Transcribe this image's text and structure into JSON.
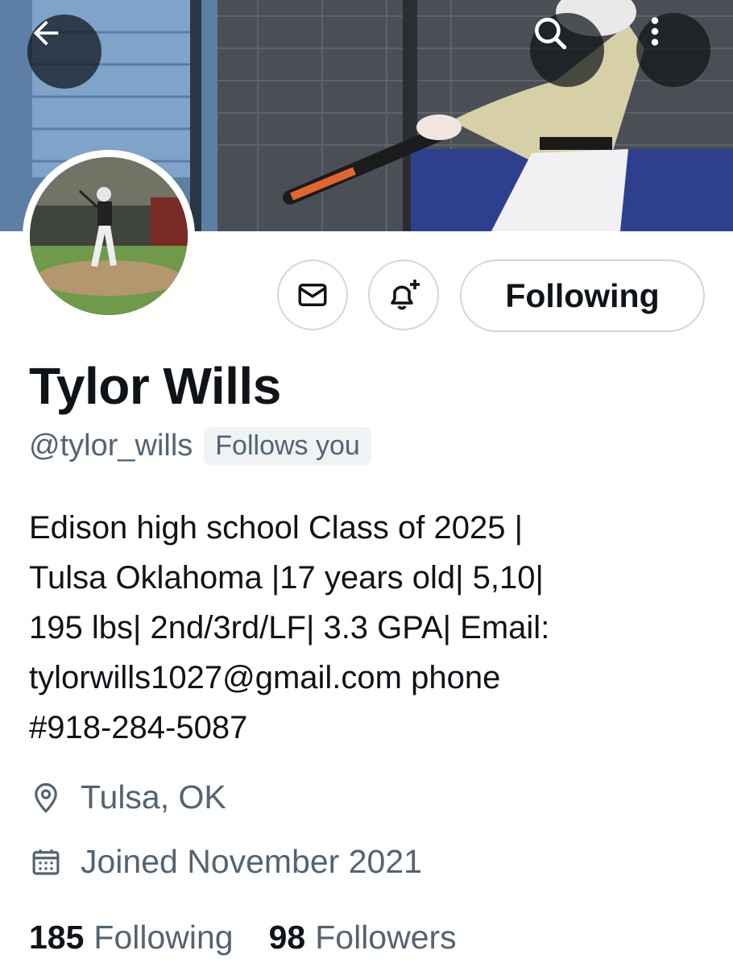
{
  "profile": {
    "name": "Tylor Wills",
    "handle": "@tylor_wills",
    "follows_you": "Follows you",
    "bio": "Edison high school Class of 2025 |\nTulsa Oklahoma |17 years old| 5,10|\n195 lbs| 2nd/3rd/LF| 3.3 GPA| Email:\ntylorwills1027@gmail.com phone\n#918-284-5087",
    "location": "Tulsa, OK",
    "joined": "Joined November 2021",
    "following_count": "185",
    "following_label": "Following",
    "followers_count": "98",
    "followers_label": "Followers"
  },
  "actions": {
    "following_button": "Following"
  },
  "icons": {
    "back": "arrow-left-icon",
    "search": "search-icon",
    "more": "more-vertical-icon",
    "message": "envelope-icon",
    "notify": "bell-plus-icon",
    "location": "location-pin-icon",
    "calendar": "calendar-icon"
  },
  "colors": {
    "text_primary": "#0f1419",
    "text_secondary": "#536471",
    "border": "#cfd9de",
    "badge_bg": "#eff3f4"
  }
}
